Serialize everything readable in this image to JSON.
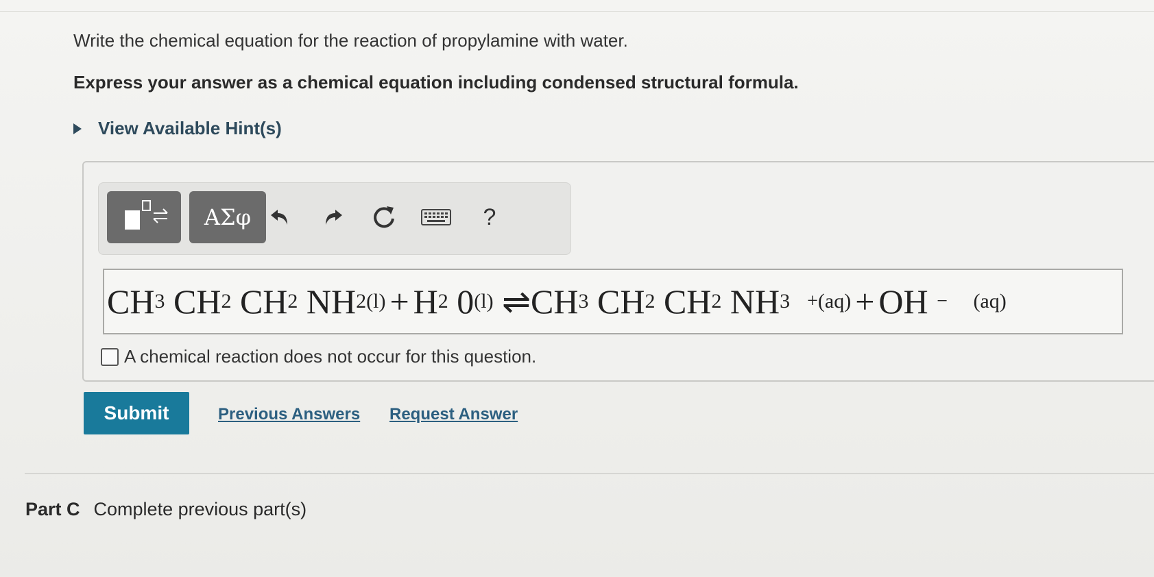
{
  "question": "Write the chemical equation for the reaction of propylamine with water.",
  "instruction": "Express your answer as a chemical equation including condensed structural formula.",
  "hint_label": "View Available Hint(s)",
  "toolbar": {
    "symbols_label": "ΑΣφ",
    "help_label": "?",
    "icons": [
      "templates-icon",
      "undo-icon",
      "redo-icon",
      "reset-icon",
      "keyboard-icon",
      "help-icon"
    ]
  },
  "equation": {
    "r1": "CH",
    "r1s": "3",
    "r2": "CH",
    "r2s": "2",
    "r3": "CH",
    "r3s": "2",
    "r4": "NH",
    "r4s": "2(l)",
    "plus1": "+",
    "w1": "H",
    "w1s": "2",
    "w2": "0",
    "w2s": "(l)",
    "arrow": "⇌",
    "p1": "CH",
    "p1s": "3",
    "p2": "CH",
    "p2s": "2",
    "p3": "CH",
    "p3s": "2",
    "p4": "NH",
    "p4s": "3",
    "p4sup": "+",
    "p4state": "(aq)",
    "plus2": "+",
    "p5": "OH",
    "p5sup": "−",
    "p5state": "(aq)"
  },
  "no_reaction_label": "A chemical reaction does not occur for this question.",
  "submit_label": "Submit",
  "previous_answers_label": "Previous Answers",
  "request_answer_label": "Request Answer",
  "part_c": {
    "label": "Part C",
    "text": "Complete previous part(s)"
  },
  "colors": {
    "submit": "#197a9b",
    "link": "#2c5f80",
    "toolbar_button": "#6b6b6b"
  }
}
